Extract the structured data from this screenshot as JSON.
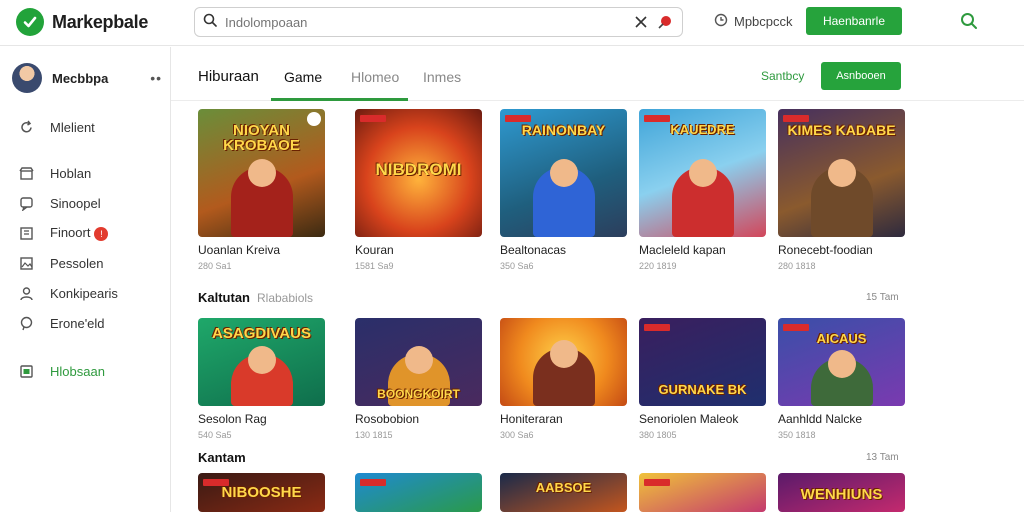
{
  "app": {
    "name": "Markepbale",
    "brand_color": "#22a33a"
  },
  "search": {
    "placeholder": "Indolompoaan"
  },
  "topbar": {
    "link_label": "Mpbcpcck",
    "button_label": "Haenbanrle"
  },
  "sidebar": {
    "profile_name": "Mecbbpa",
    "profile_more": "••",
    "items": [
      {
        "label": "Mlelient",
        "icon": "refresh-icon"
      },
      {
        "label": "Hoblan",
        "icon": "store-icon"
      },
      {
        "label": "Sinoopel",
        "icon": "chat-icon"
      },
      {
        "label": "Finoort",
        "icon": "book-icon",
        "badge": "!"
      },
      {
        "label": "Pessolen",
        "icon": "image-icon"
      },
      {
        "label": "Konkipearis",
        "icon": "user-icon"
      },
      {
        "label": "Erone'eld",
        "icon": "speech-icon"
      },
      {
        "label": "Hlobsaan",
        "icon": "window-icon",
        "active": true
      }
    ]
  },
  "main": {
    "section_title": "Hiburaan",
    "tabs": [
      {
        "label": "Game",
        "active": true
      },
      {
        "label": "Hlomeo"
      },
      {
        "label": "Inmes"
      }
    ],
    "link_label": "Santbcy",
    "button_label": "Asnbooen"
  },
  "rows": [
    {
      "header": "",
      "sub": "",
      "count": "",
      "cards": [
        {
          "title": "Uoanlan Kreiva",
          "meta": "280 Sa1",
          "art": "NIOYAN KROBAOE"
        },
        {
          "title": "Kouran",
          "meta": "1581 Sa9",
          "art": "NIBDROMI"
        },
        {
          "title": "Bealtonacas",
          "meta": "350 Sa6",
          "art": "RAINONBAY"
        },
        {
          "title": "Macleleld kapan",
          "meta": "220 1819",
          "art": "KAUEDRE"
        },
        {
          "title": "Ronecebt-foodian",
          "meta": "280 1818",
          "art": "KIMES KADABE"
        }
      ]
    },
    {
      "header": "Kaltutan",
      "sub": "Rlababiols",
      "count": "15 Tam",
      "cards": [
        {
          "title": "Sesolon Rag",
          "meta": "540 Sa5",
          "art": "ASAGDIVAUS"
        },
        {
          "title": "Rosobobion",
          "meta": "130 1815",
          "art": "BOONGKOIRT"
        },
        {
          "title": "Honiteraran",
          "meta": "300 Sa6",
          "art": ""
        },
        {
          "title": "Senoriolen Maleok",
          "meta": "380 1805",
          "art": "GURNAKE BK"
        },
        {
          "title": "Aanhldd Nalcke",
          "meta": "350 1818",
          "art": "AICAUS"
        }
      ]
    },
    {
      "header": "Kantam",
      "sub": "",
      "count": "13 Tam",
      "cards": [
        {
          "title": "",
          "meta": "",
          "art": "NIBOOSHE"
        },
        {
          "title": "",
          "meta": "",
          "art": ""
        },
        {
          "title": "",
          "meta": "",
          "art": "AABSOE"
        },
        {
          "title": "",
          "meta": "",
          "art": ""
        },
        {
          "title": "",
          "meta": "",
          "art": "WENHIUNS"
        }
      ]
    }
  ]
}
